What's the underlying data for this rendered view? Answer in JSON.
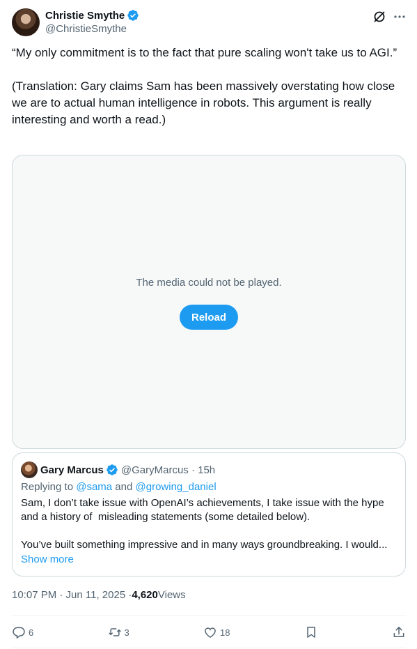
{
  "author": {
    "name": "Christie Smythe",
    "handle": "@ChristieSmythe",
    "verified": true
  },
  "header_actions": {
    "grok_icon": "grok-icon",
    "more_icon": "more-icon"
  },
  "tweet": {
    "text": "“My only commitment is to the fact that pure scaling won't take us to AGI.”\n\n(Translation: Gary claims Sam has been massively overstating how close we are to actual human intelligence in robots. This argument is really interesting and worth a read.)"
  },
  "media": {
    "message": "The media could not be played.",
    "reload_label": "Reload"
  },
  "quote": {
    "name": "Gary Marcus",
    "handle": "@GaryMarcus · 15h",
    "replying_prefix": "Replying to ",
    "mention_1": "@sama",
    "replying_and": " and ",
    "mention_2": "@growing_daniel",
    "body": "Sam, I don’t take issue with OpenAI’s achievements, I take issue with the hype and a history of  misleading statements (some detailed below).\n\nYou’ve built something impressive and in many ways groundbreaking. I would...",
    "show_more": "Show more"
  },
  "meta": {
    "time": "10:07 PM · Jun 11, 2025 · ",
    "views_count": "4,620",
    "views_label": " Views"
  },
  "actions": {
    "replies": "6",
    "reposts": "3",
    "likes": "18"
  },
  "colors": {
    "accent": "#1d9bf0",
    "secondary_text": "#536471",
    "primary_text": "#0f1419",
    "border": "#cfd9de"
  }
}
